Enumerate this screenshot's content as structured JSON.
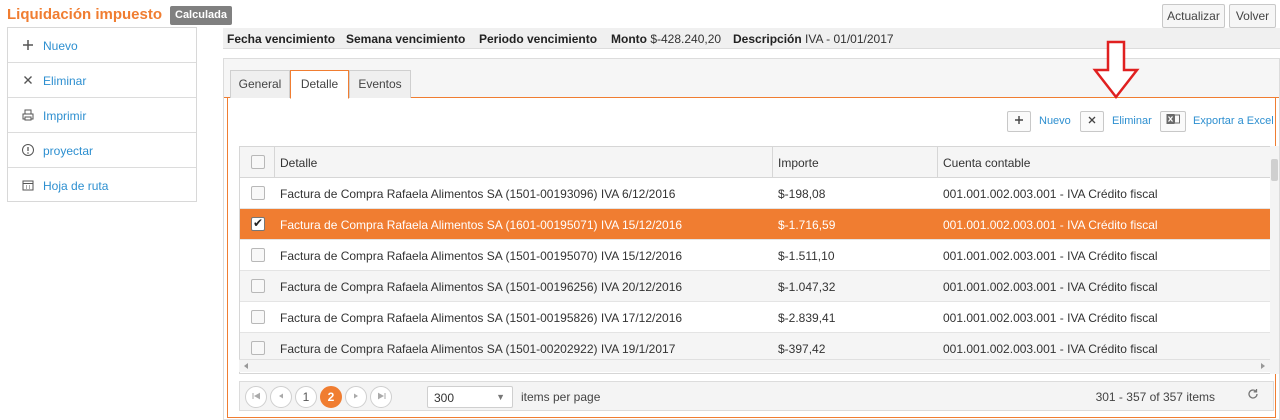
{
  "header": {
    "title": "Liquidación impuesto",
    "status": "Calculada",
    "buttons": {
      "refresh": "Actualizar",
      "back": "Volver"
    }
  },
  "sidebar": {
    "items": [
      {
        "label": "Nuevo",
        "icon": "plus-icon"
      },
      {
        "label": "Eliminar",
        "icon": "close-icon"
      },
      {
        "label": "Imprimir",
        "icon": "print-icon"
      },
      {
        "label": "proyectar",
        "icon": "info-icon"
      },
      {
        "label": "Hoja de ruta",
        "icon": "calendar-icon"
      }
    ]
  },
  "info": {
    "fecha_vencimiento_label": "Fecha vencimiento",
    "semana_vencimiento_label": "Semana vencimiento",
    "periodo_vencimiento_label": "Periodo vencimiento",
    "monto_label": "Monto",
    "monto_value": "$-428.240,20",
    "descripcion_label": "Descripción",
    "descripcion_value": "IVA - 01/01/2017"
  },
  "tabs": [
    "General",
    "Detalle",
    "Eventos"
  ],
  "active_tab": "Detalle",
  "toolbar": {
    "new_label": "Nuevo",
    "delete_label": "Eliminar",
    "export_label": "Exportar a Excel"
  },
  "grid": {
    "columns": [
      "Detalle",
      "Importe",
      "Cuenta contable"
    ],
    "rows": [
      {
        "detalle": "Factura de Compra Rafaela Alimentos SA (1501-00193096) IVA 6/12/2016",
        "importe": "$-198,08",
        "cuenta": "001.001.002.003.001 - IVA Crédito fiscal",
        "checked": false
      },
      {
        "detalle": "Factura de Compra Rafaela Alimentos SA (1601-00195071) IVA 15/12/2016",
        "importe": "$-1.716,59",
        "cuenta": "001.001.002.003.001 - IVA Crédito fiscal",
        "checked": true
      },
      {
        "detalle": "Factura de Compra Rafaela Alimentos SA (1501-00195070) IVA 15/12/2016",
        "importe": "$-1.511,10",
        "cuenta": "001.001.002.003.001 - IVA Crédito fiscal",
        "checked": false
      },
      {
        "detalle": "Factura de Compra Rafaela Alimentos SA (1501-00196256) IVA 20/12/2016",
        "importe": "$-1.047,32",
        "cuenta": "001.001.002.003.001 - IVA Crédito fiscal",
        "checked": false
      },
      {
        "detalle": "Factura de Compra Rafaela Alimentos SA (1501-00195826) IVA 17/12/2016",
        "importe": "$-2.839,41",
        "cuenta": "001.001.002.003.001 - IVA Crédito fiscal",
        "checked": false
      },
      {
        "detalle": "Factura de Compra Rafaela Alimentos SA (1501-00202922) IVA 19/1/2017",
        "importe": "$-397,42",
        "cuenta": "001.001.002.003.001 - IVA Crédito fiscal",
        "checked": false
      }
    ]
  },
  "pager": {
    "pages": [
      "1",
      "2"
    ],
    "current_page": "2",
    "page_size": "300",
    "items_per_page_label": "items per page",
    "range_text": "301 - 357 of 357 items"
  },
  "colors": {
    "accent": "#f07d31",
    "link": "#2d8fd0",
    "badge": "#808080",
    "annotation_arrow": "#e02020"
  }
}
